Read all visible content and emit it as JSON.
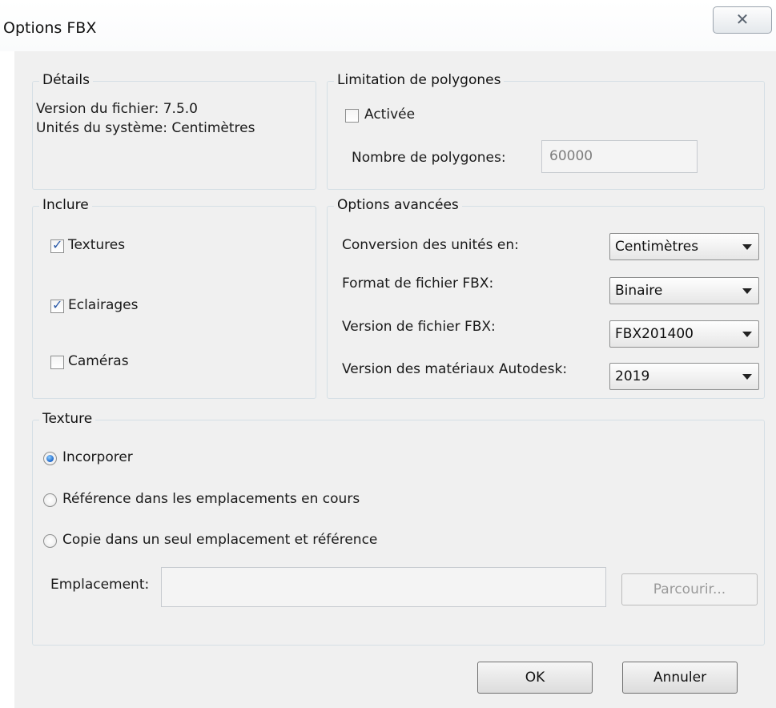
{
  "window": {
    "title": "Options FBX",
    "close_glyph": "✕"
  },
  "details": {
    "title": "Détails",
    "version_line": "Version du fichier: 7.5.0",
    "units_line": "Unités du système: Centimètres"
  },
  "polygon_limit": {
    "title": "Limitation de polygones",
    "enabled_label": "Activée",
    "enabled": false,
    "count_label": "Nombre de polygones:",
    "count_value": "60000"
  },
  "include": {
    "title": "Inclure",
    "items": [
      {
        "label": "Textures",
        "checked": true
      },
      {
        "label": "Eclairages",
        "checked": true
      },
      {
        "label": "Caméras",
        "checked": false
      }
    ]
  },
  "advanced": {
    "title": "Options avancées",
    "rows": [
      {
        "label": "Conversion des unités en:",
        "value": "Centimètres"
      },
      {
        "label": "Format de fichier FBX:",
        "value": "Binaire"
      },
      {
        "label": "Version de fichier FBX:",
        "value": "FBX201400"
      },
      {
        "label": "Version des matériaux Autodesk:",
        "value": "2019"
      }
    ]
  },
  "texture": {
    "title": "Texture",
    "options": [
      {
        "label": "Incorporer",
        "selected": true
      },
      {
        "label": "Référence dans les emplacements en cours",
        "selected": false
      },
      {
        "label": "Copie dans un seul emplacement et référence",
        "selected": false
      }
    ],
    "location_label": "Emplacement:",
    "location_value": "",
    "browse_label": "Parcourir..."
  },
  "buttons": {
    "ok": "OK",
    "cancel": "Annuler"
  }
}
